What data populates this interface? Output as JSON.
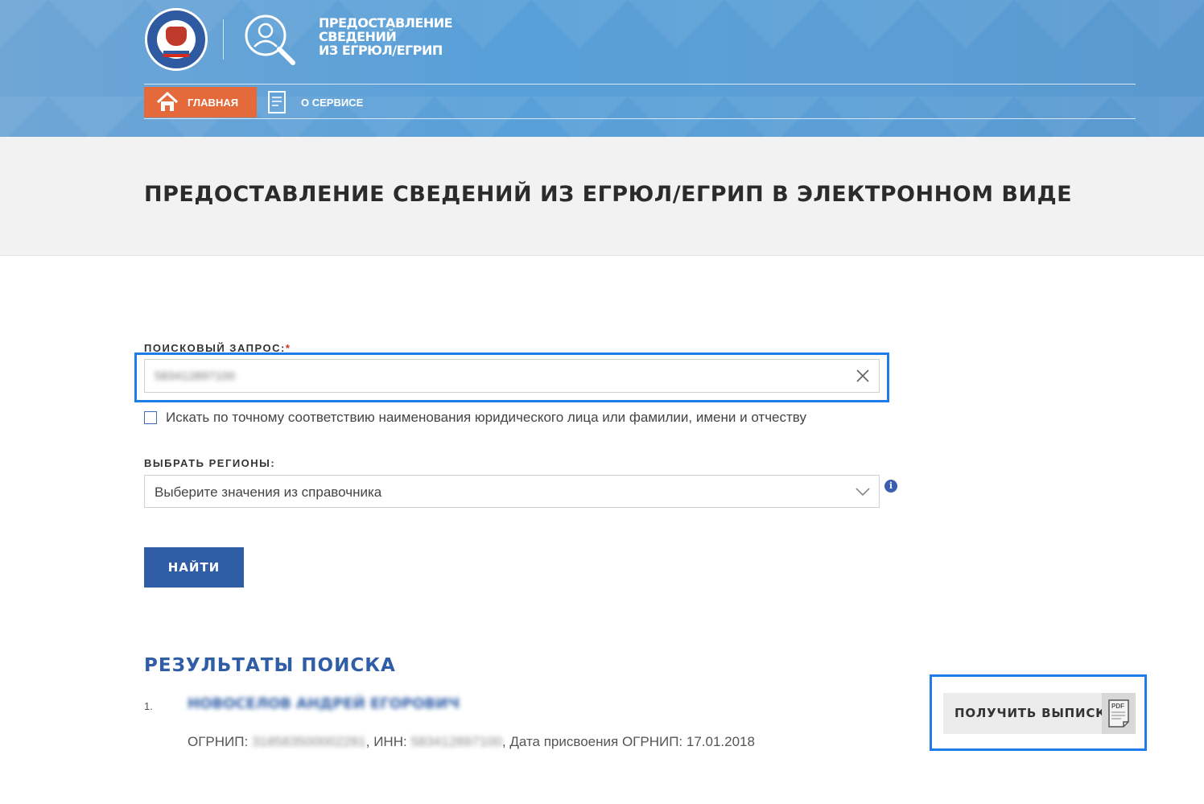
{
  "header": {
    "logo_title_lines": [
      "ПРЕДОСТАВЛЕНИЕ",
      "СВЕДЕНИЙ",
      "ИЗ ЕГРЮЛ/ЕГРИП"
    ],
    "nav": {
      "home_label": "ГЛАВНАЯ",
      "about_label": "О СЕРВИСЕ"
    }
  },
  "page": {
    "title": "ПРЕДОСТАВЛЕНИЕ СВЕДЕНИЙ ИЗ ЕГРЮЛ/ЕГРИП В ЭЛЕКТРОННОМ ВИДЕ"
  },
  "form": {
    "search_label": "ПОИСКОВЫЙ ЗАПРОС:",
    "required_mark": "*",
    "search_value": "583412897100",
    "exact_match_label": "Искать по точному соответствию наименования юридического лица или фамилии, имени и отчеству",
    "exact_match_checked": false,
    "region_label": "ВЫБРАТЬ РЕГИОНЫ:",
    "region_placeholder": "Выберите значения из справочника",
    "info_symbol": "i",
    "find_button": "НАЙТИ"
  },
  "results": {
    "title": "РЕЗУЛЬТАТЫ ПОИСКА",
    "items": [
      {
        "number": "1.",
        "name": "НОВОСЕЛОВ АНДРЕЙ ЕГОРОВИЧ",
        "ogrnip_label": "ОГРНИП: ",
        "ogrnip": "318583500002281",
        "inn_label": ", ИНН: ",
        "inn": "583412897100",
        "date_label": ", Дата присвоения ОГРНИП: ",
        "date": "17.01.2018",
        "extract_button": "ПОЛУЧИТЬ ВЫПИСКУ",
        "pdf_icon_text": "PDF"
      }
    ]
  },
  "colors": {
    "accent_blue": "#2f5ea7",
    "nav_orange": "#e46a3c",
    "highlight": "#1d7bea"
  }
}
